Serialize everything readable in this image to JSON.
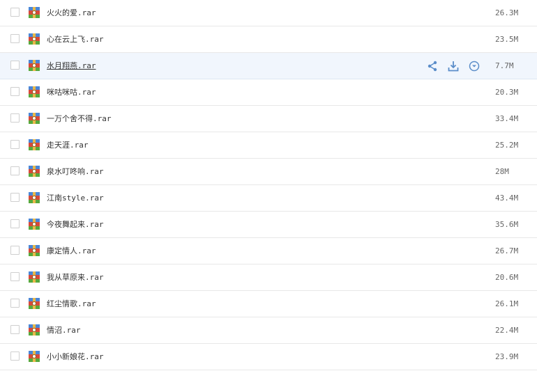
{
  "files": [
    {
      "name": "火火的爱.rar",
      "size": "26.3M"
    },
    {
      "name": "心在云上飞.rar",
      "size": "23.5M"
    },
    {
      "name": "水月翔燕.rar",
      "size": "7.7M",
      "hovered": true
    },
    {
      "name": "咪咕咪咕.rar",
      "size": "20.3M"
    },
    {
      "name": "一万个舍不得.rar",
      "size": "33.4M"
    },
    {
      "name": "走天涯.rar",
      "size": "25.2M"
    },
    {
      "name": "泉水叮咚响.rar",
      "size": "28M"
    },
    {
      "name": "江南style.rar",
      "size": "43.4M"
    },
    {
      "name": "今夜舞起来.rar",
      "size": "35.6M"
    },
    {
      "name": "康定情人.rar",
      "size": "26.7M"
    },
    {
      "name": "我从草原来.rar",
      "size": "20.6M"
    },
    {
      "name": "红尘情歌.rar",
      "size": "26.1M"
    },
    {
      "name": "情沼.rar",
      "size": "22.4M"
    },
    {
      "name": "小小新娘花.rar",
      "size": "23.9M"
    }
  ],
  "icons": {
    "file": "rar-archive-icon",
    "actions": [
      "share-icon",
      "download-icon",
      "more-dropdown-icon"
    ]
  },
  "colors": {
    "accent": "#5b8dc9",
    "hover_row": "#f1f6fd",
    "divider": "#e8e8e8"
  }
}
